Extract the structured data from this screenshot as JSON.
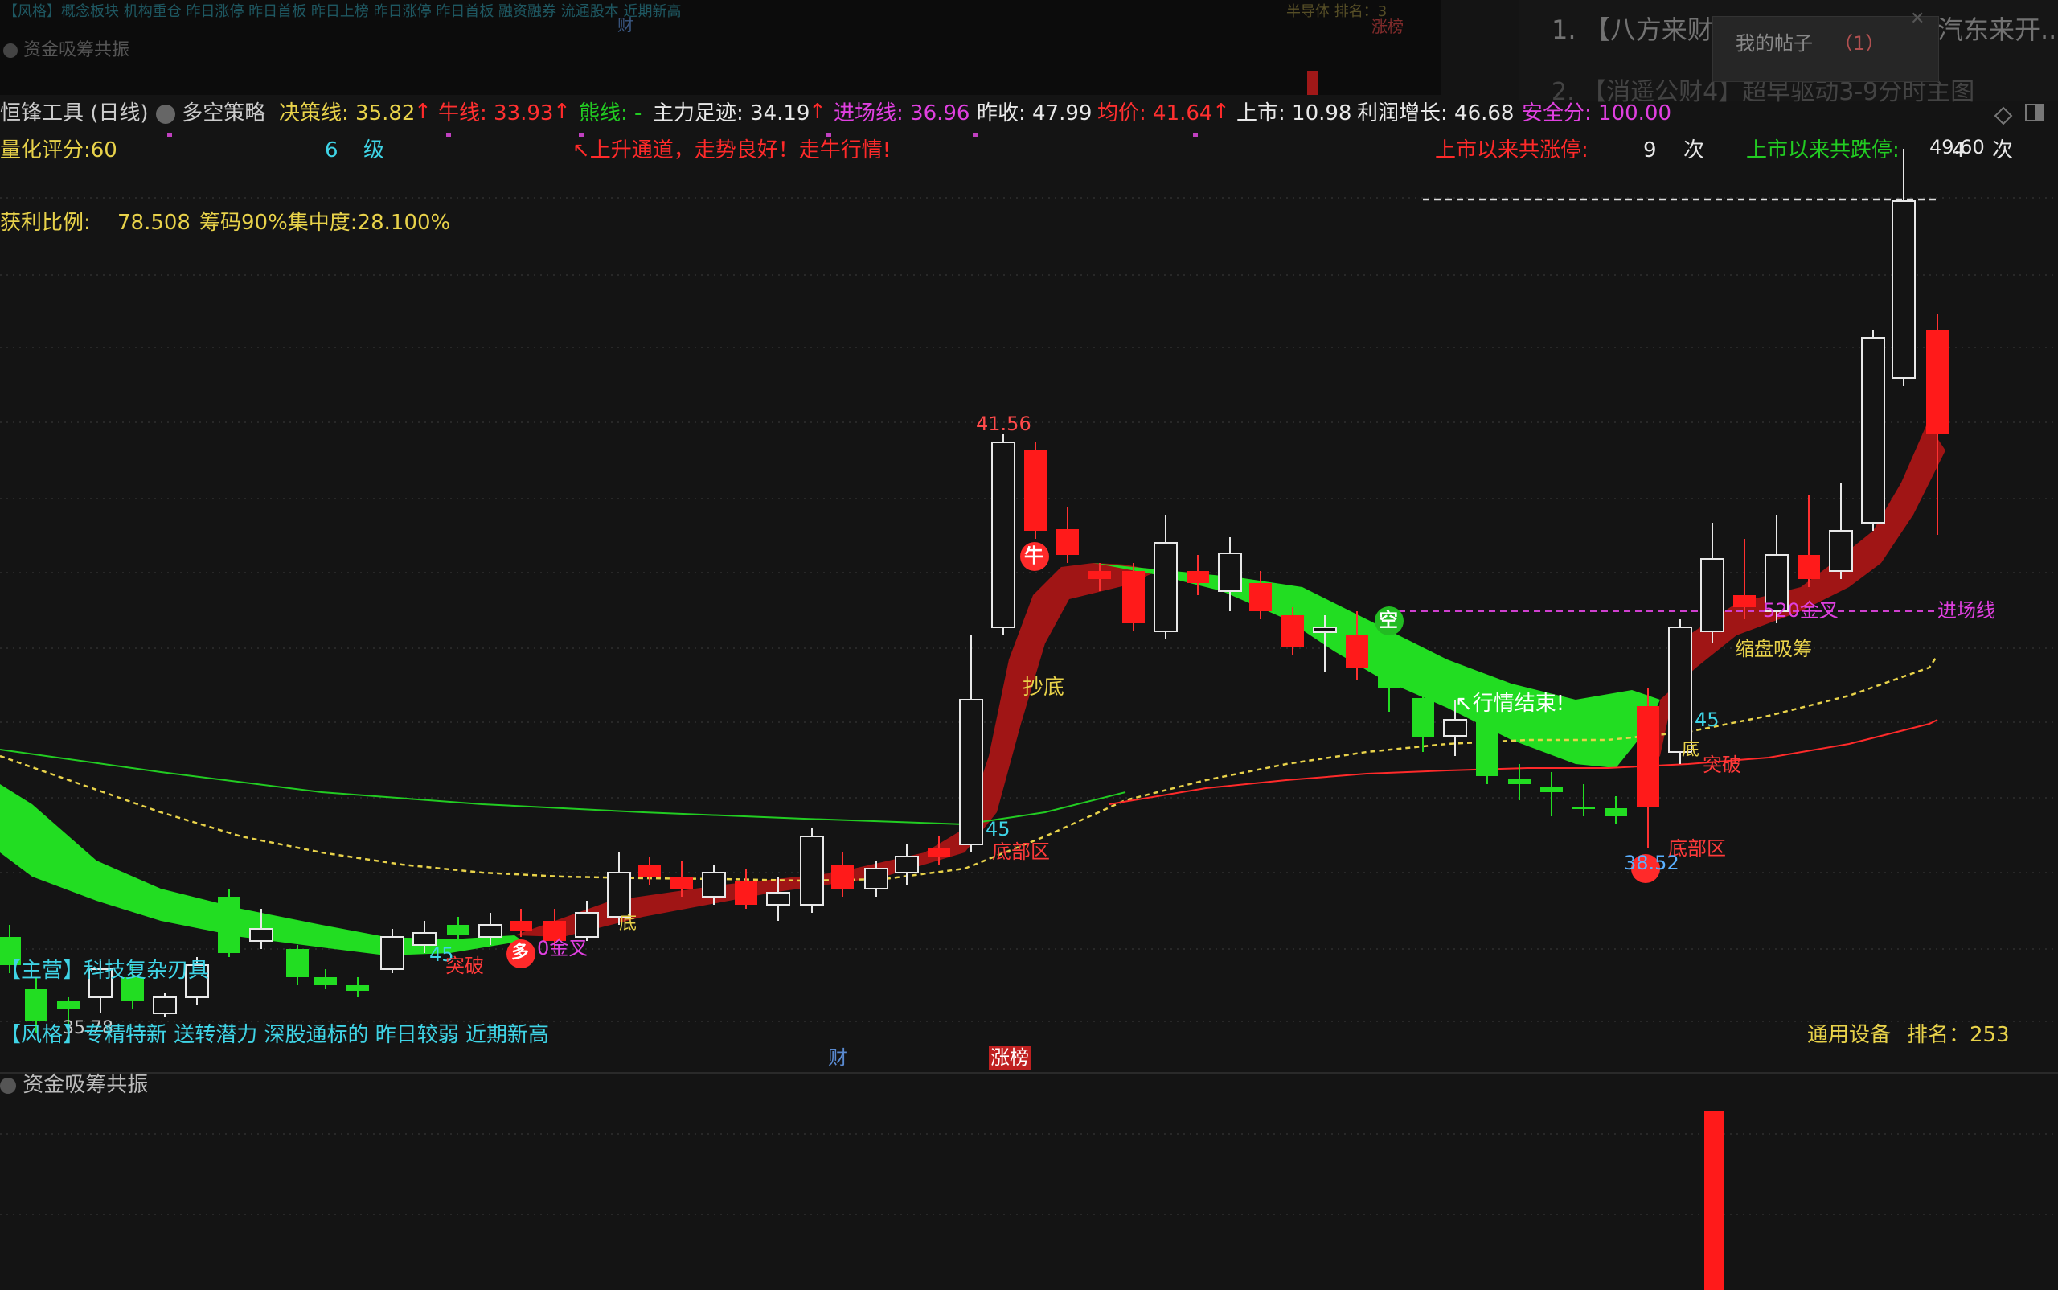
{
  "top_strip": {
    "ticker_tags": "【风格】概念板块 机构重仓 昨日涨停 昨日首板 昨日上榜 昨日涨停 昨日首板 融资融券 流通股本 近期新高",
    "cai": "财",
    "zhangbang": "涨榜",
    "top_right": "半导体  排名：3",
    "panel_label": "资金吸筹共振"
  },
  "right_panel": {
    "news1": "1. 【八方来财",
    "news1_tail": "汽东来开...",
    "news2": "2. 【消遥公财4】超早驱动3-9分时主图",
    "popup_label": "我的帖子",
    "popup_count": "（1）",
    "popup_close": "✕"
  },
  "header": {
    "tool": "恒锋工具 (日线)",
    "strategy": "多空策略",
    "decision": "决策线: 35.82",
    "bull": "牛线: 33.93",
    "bear": "熊线: -",
    "main_force": "主力足迹: 34.19",
    "entry": "进场线: 36.96",
    "prev_close": "昨收: 47.99",
    "avg_price": "均价: 41.64",
    "listed": "上市: 10.98",
    "profit_growth": "利润增长: 46.68",
    "safety": "安全分: 100.00",
    "arrow": "↑"
  },
  "row2": {
    "score": "量化评分:60",
    "level_num": "6",
    "level": "级",
    "channel_msg": "↖上升通道，走势良好！走牛行情!",
    "limit_up_label": "上市以来共涨停:",
    "limit_up_num": "9",
    "times": "次",
    "limit_down_label": "上市以来共跌停:",
    "limit_down_num": "4",
    "times2": "次"
  },
  "row3": {
    "profit_ratio_label": "获利比例:",
    "profit_ratio": "78.508",
    "chip_label": "筹码90%集中度:28.100%"
  },
  "annotations": {
    "high1": "41.56",
    "bull_marker": "牛",
    "bottom_buy": "抄底",
    "short_marker": "空",
    "trend_end": "↖行情结束!",
    "n45_a": "45",
    "bottom_zone_a": "底部区",
    "n45_b": "45",
    "bottom_zone_b": "底部区",
    "low_val": "38.52",
    "breakthrough_b": "突破",
    "cross520": "520金叉",
    "entry_line": "进场线",
    "absorb": "缩盘吸筹",
    "high2": "49.60",
    "n45_c": "45",
    "breakthrough_c": "突破",
    "gold_cross": "0金叉",
    "duo": "多",
    "di": "底",
    "low_left": "35.78",
    "di2": "底"
  },
  "bottom_info": {
    "main_biz": "【主营】科技复杂刃具",
    "style_tags": "【风格】专精特新 送转潜力 深股通标的 昨日较弱 近期新高",
    "industry": "通用设备",
    "rank": "排名：253",
    "cai": "财",
    "zhangbang": "涨榜"
  },
  "lower_panel": {
    "title": "资金吸筹共振"
  },
  "colors": {
    "red": "#ff2a2a",
    "green": "#22dd22",
    "yellow": "#e8d24a",
    "magenta": "#e040e0",
    "cyan": "#3fd4e6"
  }
}
